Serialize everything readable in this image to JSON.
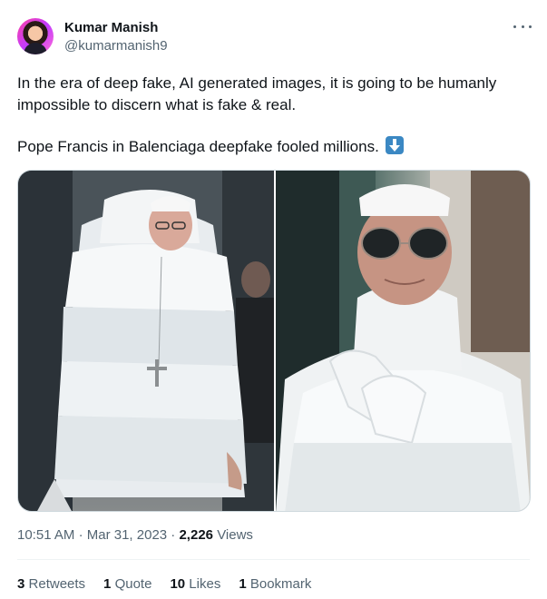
{
  "author": {
    "name": "Kumar Manish",
    "handle": "@kumarmanish9"
  },
  "tweet": {
    "line1": "In the era of deep fake, AI generated images, it is going to be humanly impossible to discern what is fake & real.",
    "line2": "Pope Francis in Balenciaga deepfake fooled millions.",
    "emoji": "down-arrow-emoji"
  },
  "media": {
    "images": [
      {
        "icon": "pope-puffer-coat-full-length-photo"
      },
      {
        "icon": "pope-puffer-coat-sunglasses-closeup-photo"
      }
    ]
  },
  "meta": {
    "time": "10:51 AM",
    "separator": "·",
    "date": "Mar 31, 2023",
    "views_count": "2,226",
    "views_label": "Views"
  },
  "stats": {
    "retweets_count": "3",
    "retweets_label": "Retweets",
    "quotes_count": "1",
    "quotes_label": "Quote",
    "likes_count": "10",
    "likes_label": "Likes",
    "bookmarks_count": "1",
    "bookmarks_label": "Bookmark"
  },
  "colors": {
    "text_primary": "#0f1419",
    "text_secondary": "#536471",
    "border": "#cfd9de",
    "emoji_blue": "#3b88c3"
  }
}
